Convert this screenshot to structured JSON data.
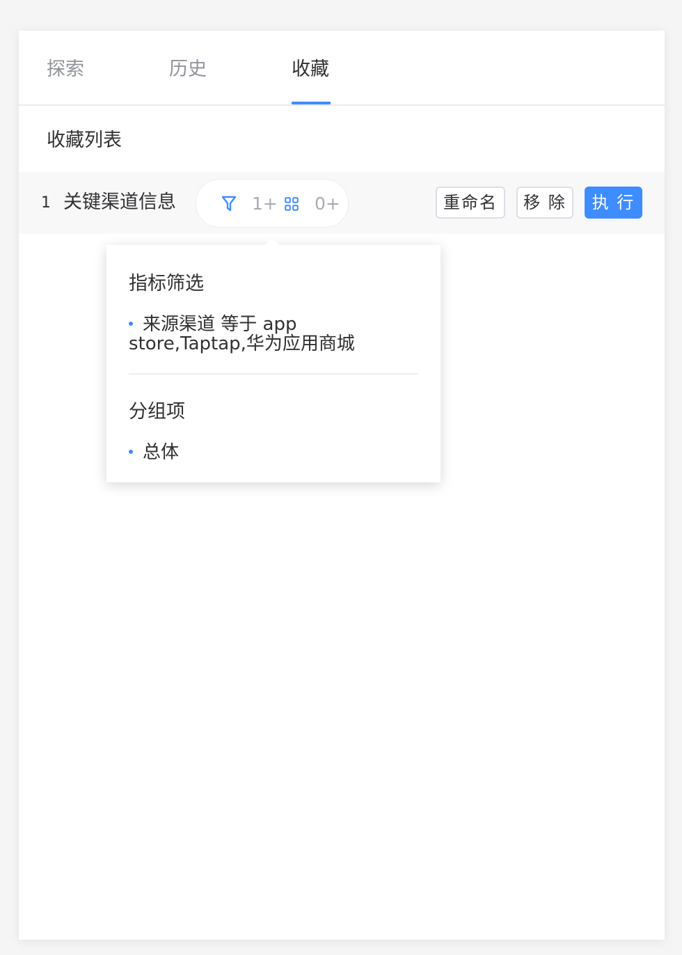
{
  "tabs": [
    {
      "label": "探索",
      "active": false
    },
    {
      "label": "历史",
      "active": false
    },
    {
      "label": "收藏",
      "active": true
    }
  ],
  "favorites": {
    "section_title": "收藏列表",
    "items": [
      {
        "index": "1",
        "name": "关键渠道信息",
        "filter_count": "1+",
        "group_count": "0+",
        "actions": {
          "rename": "重命名",
          "remove": "移 除",
          "execute": "执 行"
        }
      }
    ]
  },
  "popover": {
    "filter_title": "指标筛选",
    "filters": [
      "来源渠道 等于 app store,Taptap,华为应用商城"
    ],
    "group_title": "分组项",
    "groups": [
      "总体"
    ]
  },
  "colors": {
    "accent": "#3f8cff",
    "text_primary": "#303133",
    "text_muted": "#909399"
  },
  "icons": {
    "filter": "filter-icon",
    "grid": "grid-icon"
  }
}
